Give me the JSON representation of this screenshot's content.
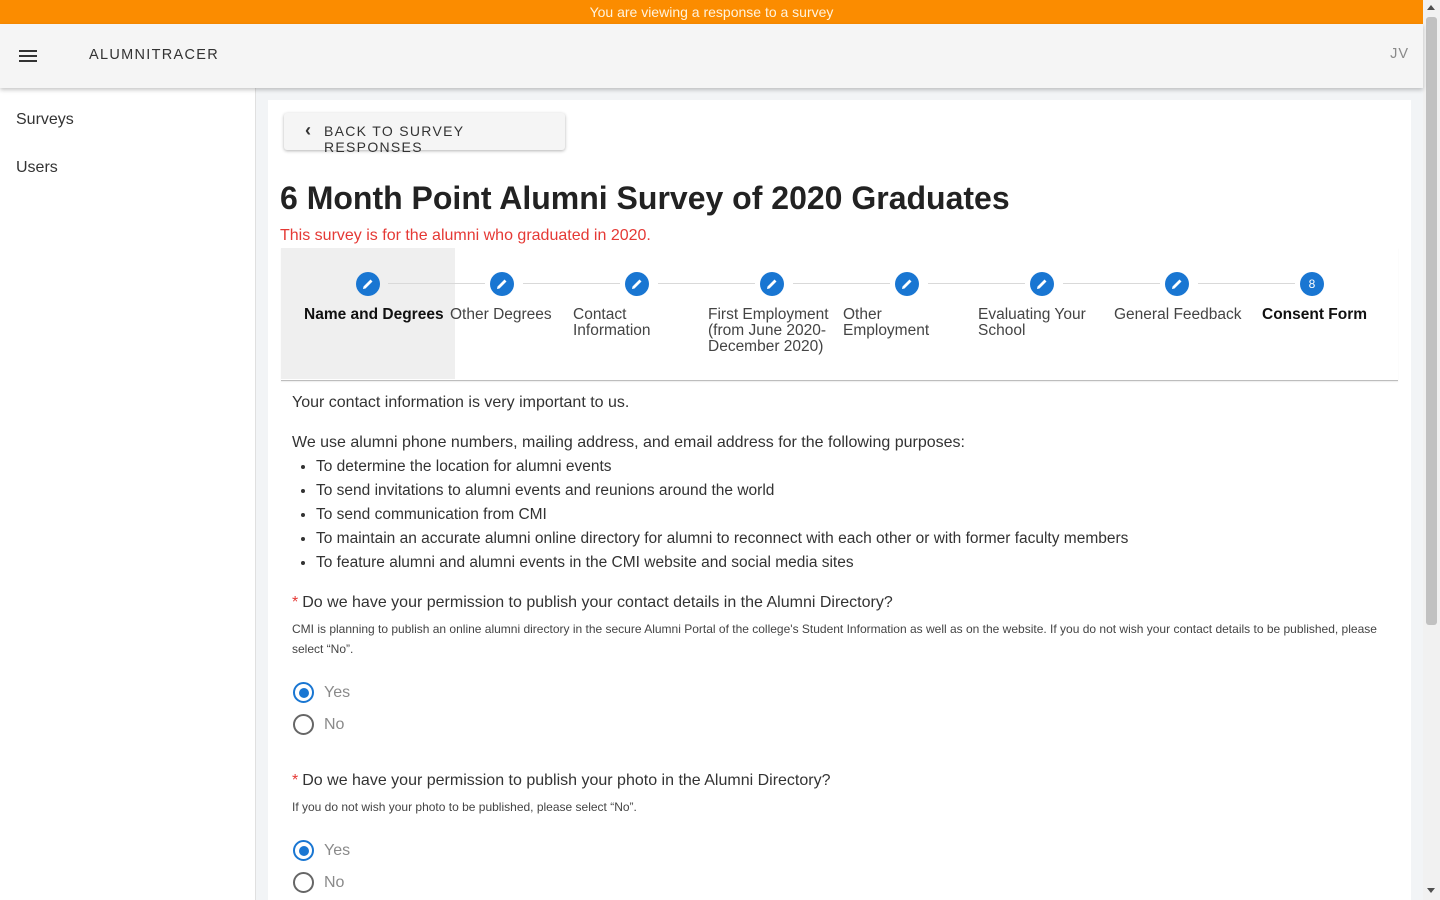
{
  "banner": "You are viewing a response to a survey",
  "app": {
    "title": "ALUMNITRACER",
    "avatar": "JV",
    "menu_icon": "menu-icon"
  },
  "sidebar": {
    "items": [
      {
        "label": "Surveys"
      },
      {
        "label": "Users"
      }
    ]
  },
  "back_button": {
    "label": "BACK TO SURVEY RESPONSES",
    "icon": "chevron-left-icon"
  },
  "survey": {
    "title": "6 Month Point Alumni Survey of 2020 Graduates",
    "subtitle": "This survey is for the alumni who graduated in 2020."
  },
  "steps": [
    {
      "label": "Name and Degrees",
      "state": "edit",
      "active": true
    },
    {
      "label": "Other Degrees",
      "state": "edit"
    },
    {
      "label": "Contact Information",
      "state": "edit"
    },
    {
      "label": "First Employment (from June 2020-December 2020)",
      "state": "edit"
    },
    {
      "label": "Other Employment",
      "state": "edit"
    },
    {
      "label": "Evaluating Your School",
      "state": "edit"
    },
    {
      "label": "General Feedback",
      "state": "edit"
    },
    {
      "label": "Consent Form",
      "state": "number",
      "number": "8"
    }
  ],
  "content": {
    "intro": "Your contact information is very important to us.",
    "purposes_intro": "We use alumni phone numbers, mailing address, and email address for the following purposes:",
    "purposes": [
      "To determine the location for alumni events",
      "To send invitations to alumni events and reunions around the world",
      "To send communication from CMI",
      "To maintain an accurate alumni online directory for alumni to reconnect with each other or with former faculty members",
      "To feature alumni and alumni events in the CMI website and social media sites"
    ]
  },
  "questions": [
    {
      "required_mark": "*",
      "text": "Do we have your permission to publish your contact details in the Alumni Directory?",
      "hint": "CMI is planning to publish an online alumni directory in the secure Alumni Portal of the college's Student Information as well as on the website. If you do not wish your contact details to be published, please select “No”.",
      "options": [
        {
          "label": "Yes",
          "selected": true
        },
        {
          "label": "No",
          "selected": false
        }
      ]
    },
    {
      "required_mark": "*",
      "text": "Do we have your permission to publish your photo in the Alumni Directory?",
      "hint": "If you do not wish your photo to be published, please select “No”.",
      "options": [
        {
          "label": "Yes",
          "selected": true
        },
        {
          "label": "No",
          "selected": false
        }
      ]
    }
  ],
  "colors": {
    "banner": "#fb8c00",
    "primary": "#1976d2",
    "required": "#e53935"
  }
}
